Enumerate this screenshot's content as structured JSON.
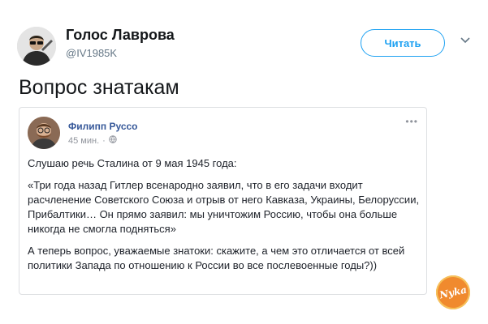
{
  "tweet": {
    "author_name": "Голос Лаврова",
    "author_handle": "@IV1985K",
    "follow_label": "Читать",
    "text": "Вопрос знатакам"
  },
  "embedded_post": {
    "author_name": "Филипп Руссо",
    "time": "45 мин.",
    "separator": "·",
    "paragraphs": [
      "Слушаю речь Сталина от 9 мая 1945 года:",
      "«Три года назад Гитлер всенародно заявил, что в его задачи входит расчленение Советского Союза и отрыв от него Кавказа, Украины, Белоруссии, Прибалтики… Он прямо заявил: мы уничтожим Россию, чтобы она больше никогда не смогла подняться»",
      "А теперь вопрос, уважаемые знатоки: скажите, а чем это отличается от всей политики Запада по отношению к России во все послевоенные годы?))"
    ]
  },
  "watermark": {
    "text": "Nyka"
  },
  "colors": {
    "follow_accent": "#1da1f2",
    "fb_name": "#365899",
    "watermark": "#f08a2e"
  }
}
